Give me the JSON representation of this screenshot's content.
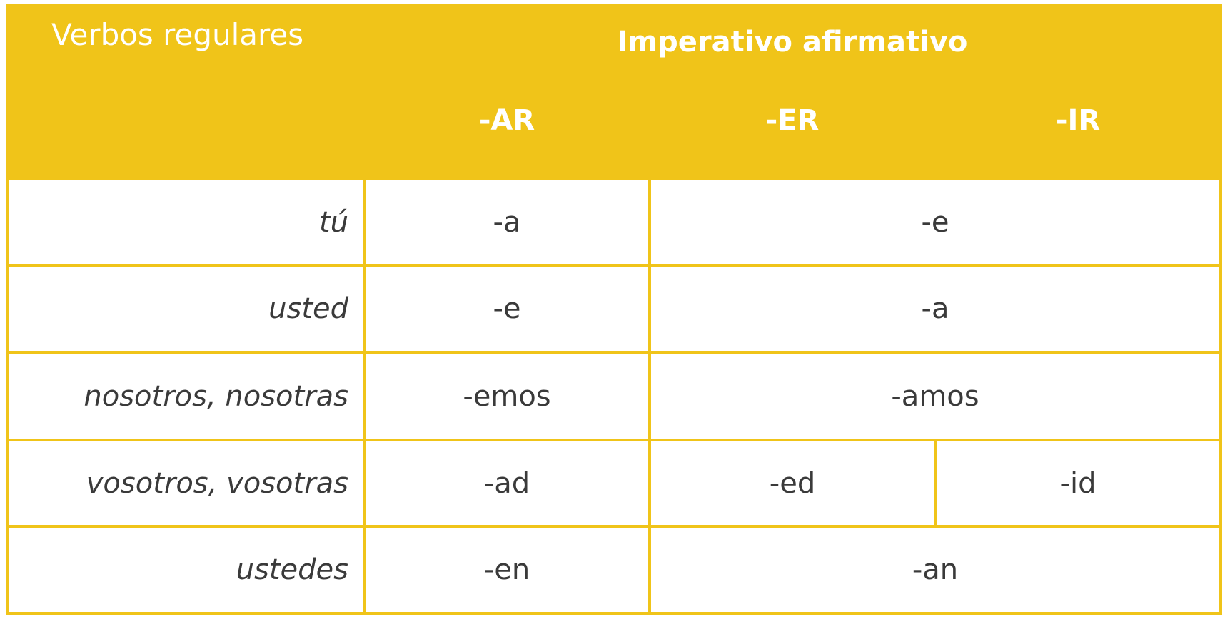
{
  "header": {
    "corner_label": "Verbos regulares",
    "group_title": "Imperativo afirmativo",
    "columns": [
      "-AR",
      "-ER",
      "-IR"
    ]
  },
  "rows": [
    {
      "person": "tú",
      "ar": "-a",
      "er_ir": "-e"
    },
    {
      "person": "usted",
      "ar": "-e",
      "er_ir": "-a"
    },
    {
      "person": "nosotros, nosotras",
      "ar": "-emos",
      "er_ir": "-amos"
    },
    {
      "person": "vosotros, vosotras",
      "ar": "-ad",
      "er": "-ed",
      "ir": "-id"
    },
    {
      "person": "ustedes",
      "ar": "-en",
      "er_ir": "-an"
    }
  ],
  "colors": {
    "accent": "#F0C419",
    "text": "#3a3a3a",
    "header_text": "#ffffff"
  }
}
